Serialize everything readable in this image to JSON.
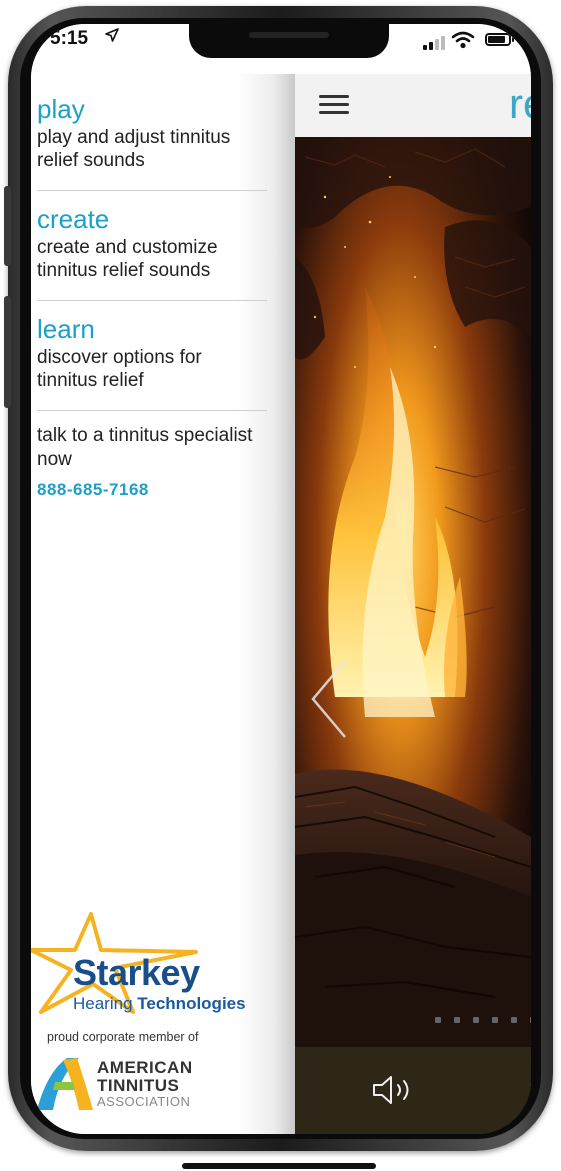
{
  "status_bar": {
    "time": "5:15",
    "location_icon": "location-arrow-icon",
    "signal_icon": "cellular-signal-icon",
    "wifi_icon": "wifi-icon",
    "battery_icon": "battery-icon"
  },
  "header": {
    "title_partial": "re",
    "menu_icon": "hamburger-menu-icon"
  },
  "drawer": {
    "items": [
      {
        "title": "play",
        "description": "play and adjust tinnitus relief sounds"
      },
      {
        "title": "create",
        "description": "create and customize tinnitus relief sounds"
      },
      {
        "title": "learn",
        "description": "discover options for tinnitus relief"
      }
    ],
    "talk": {
      "text": "talk to a tinnitus specialist now",
      "phone": "888-685-7168"
    },
    "starkey": {
      "name": "Starkey",
      "sub_regular": "Hearing ",
      "sub_bold": "Technologies"
    },
    "proud_text": "proud corporate member of",
    "ata": {
      "line1": "AMERICAN",
      "line2": "TINNITUS",
      "line3": "ASSOCIATION"
    }
  },
  "player": {
    "scene": "fireplace",
    "prev_icon": "chevron-left-icon",
    "volume_icon": "speaker-volume-icon",
    "page_count": 6
  },
  "colors": {
    "accent": "#1aa0c9",
    "starkey_blue": "#1a4e8a",
    "starkey_star": "#f5b320",
    "bottom_bar": "#2e2616"
  }
}
